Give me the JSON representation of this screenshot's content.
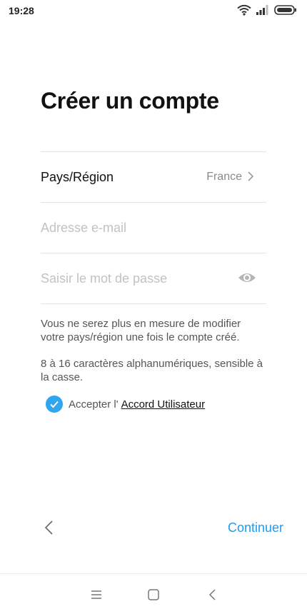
{
  "status_bar": {
    "time": "19:28",
    "icons": [
      "wifi-icon",
      "signal-icon",
      "battery-icon"
    ]
  },
  "header": {
    "title": "Créer un compte"
  },
  "form": {
    "country_label": "Pays/Région",
    "country_value": "France",
    "email_placeholder": "Adresse e-mail",
    "email_value": "",
    "password_placeholder": "Saisir le mot de passe",
    "password_value": ""
  },
  "hints": {
    "region_notice": "Vous ne serez plus en mesure de modifier votre pays/région une fois le compte créé.",
    "password_rule": "8 à 16 caractères alphanumériques, sensible à la casse."
  },
  "agreement": {
    "checked": true,
    "text": "Accepter l'",
    "link": "Accord Utilisateur"
  },
  "footer": {
    "continue_label": "Continuer"
  },
  "colors": {
    "accent": "#1e9bf0",
    "checkbox": "#2ea6f0",
    "text_primary": "#111111",
    "text_secondary": "#555555",
    "placeholder": "#c2c2c2"
  }
}
